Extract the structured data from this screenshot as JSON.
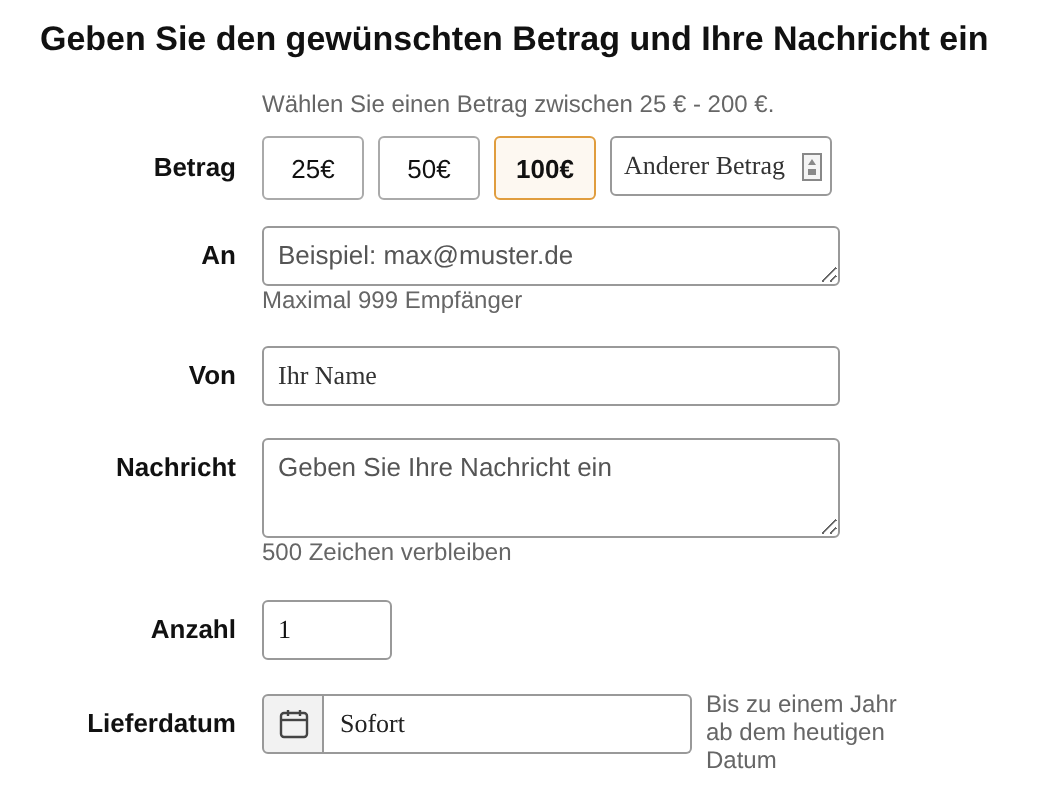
{
  "heading": "Geben Sie den gewünschten Betrag und Ihre Nachricht ein",
  "amount": {
    "hint": "Wählen Sie einen Betrag zwischen 25 € - 200 €.",
    "label": "Betrag",
    "options": [
      {
        "label": "25€",
        "selected": false
      },
      {
        "label": "50€",
        "selected": false
      },
      {
        "label": "100€",
        "selected": true
      }
    ],
    "custom": {
      "placeholder": "Anderer Betrag"
    }
  },
  "recipient": {
    "label": "An",
    "placeholder": "Beispiel: max@muster.de",
    "hint": "Maximal 999 Empfänger"
  },
  "sender": {
    "label": "Von",
    "placeholder": "Ihr Name"
  },
  "message": {
    "label": "Nachricht",
    "placeholder": "Geben Sie Ihre Nachricht ein",
    "hint": "500 Zeichen verbleiben"
  },
  "quantity": {
    "label": "Anzahl",
    "value": "1"
  },
  "delivery": {
    "label": "Lieferdatum",
    "value": "Sofort",
    "note": "Bis zu einem Jahr ab dem heutigen Datum"
  }
}
